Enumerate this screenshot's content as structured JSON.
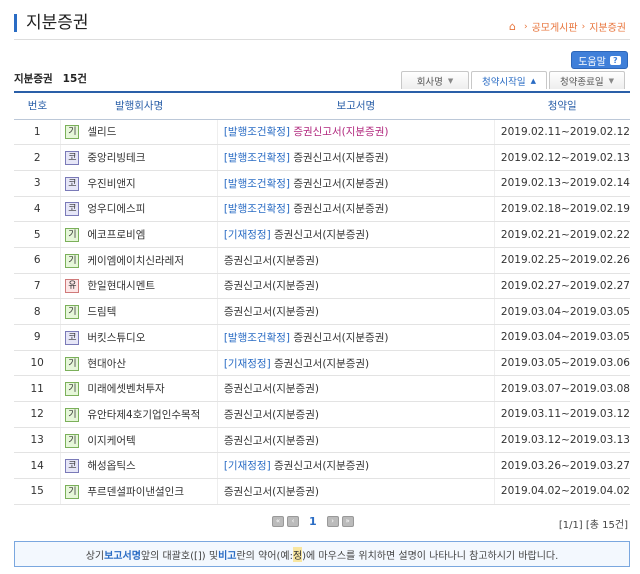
{
  "header": {
    "title": "지분증권",
    "crumbs": [
      "공모게시판",
      "지분증권"
    ]
  },
  "help_label": "도움말",
  "count": {
    "label": "지분증권",
    "value": "15건"
  },
  "sort_tabs": [
    {
      "label": "회사명",
      "active": false
    },
    {
      "label": "청약시작일",
      "active": true
    },
    {
      "label": "청약종료일",
      "active": false
    }
  ],
  "columns": [
    "번호",
    "발행회사명",
    "보고서명",
    "청약일"
  ],
  "rows": [
    {
      "no": "1",
      "market": "기",
      "company": "셀리드",
      "tag": "[발행조건확정]",
      "report": "증권신고서(지분증권)",
      "period": "2019.02.11~2019.02.12",
      "pink": true
    },
    {
      "no": "2",
      "market": "코",
      "company": "중앙리빙테크",
      "tag": "[발행조건확정]",
      "report": "증권신고서(지분증권)",
      "period": "2019.02.12~2019.02.13",
      "pink": false
    },
    {
      "no": "3",
      "market": "코",
      "company": "우진비앤지",
      "tag": "[발행조건확정]",
      "report": "증권신고서(지분증권)",
      "period": "2019.02.13~2019.02.14",
      "pink": false
    },
    {
      "no": "4",
      "market": "코",
      "company": "엉우디에스피",
      "tag": "[발행조건확정]",
      "report": "증권신고서(지분증권)",
      "period": "2019.02.18~2019.02.19",
      "pink": false
    },
    {
      "no": "5",
      "market": "기",
      "company": "에코프로비엠",
      "tag": "[기재정정]",
      "report": "증권신고서(지분증권)",
      "period": "2019.02.21~2019.02.22",
      "pink": false
    },
    {
      "no": "6",
      "market": "기",
      "company": "케이엠에이치신라레저",
      "tag": "",
      "report": "증권신고서(지분증권)",
      "period": "2019.02.25~2019.02.26",
      "pink": false
    },
    {
      "no": "7",
      "market": "유",
      "company": "한일현대시멘트",
      "tag": "",
      "report": "증권신고서(지분증권)",
      "period": "2019.02.27~2019.02.27",
      "pink": false
    },
    {
      "no": "8",
      "market": "기",
      "company": "드림텍",
      "tag": "",
      "report": "증권신고서(지분증권)",
      "period": "2019.03.04~2019.03.05",
      "pink": false
    },
    {
      "no": "9",
      "market": "코",
      "company": "버킷스튜디오",
      "tag": "[발행조건확정]",
      "report": "증권신고서(지분증권)",
      "period": "2019.03.04~2019.03.05",
      "pink": false
    },
    {
      "no": "10",
      "market": "기",
      "company": "현대아산",
      "tag": "[기재정정]",
      "report": "증권신고서(지분증권)",
      "period": "2019.03.05~2019.03.06",
      "pink": false
    },
    {
      "no": "11",
      "market": "기",
      "company": "미래에셋벤처투자",
      "tag": "",
      "report": "증권신고서(지분증권)",
      "period": "2019.03.07~2019.03.08",
      "pink": false
    },
    {
      "no": "12",
      "market": "기",
      "company": "유안타제4호기업인수목적",
      "tag": "",
      "report": "증권신고서(지분증권)",
      "period": "2019.03.11~2019.03.12",
      "pink": false
    },
    {
      "no": "13",
      "market": "기",
      "company": "이지케어텍",
      "tag": "",
      "report": "증권신고서(지분증권)",
      "period": "2019.03.12~2019.03.13",
      "pink": false
    },
    {
      "no": "14",
      "market": "코",
      "company": "해성옵틱스",
      "tag": "[기재정정]",
      "report": "증권신고서(지분증권)",
      "period": "2019.03.26~2019.03.27",
      "pink": false
    },
    {
      "no": "15",
      "market": "기",
      "company": "푸르덴셜파이낸셜인크",
      "tag": "",
      "report": "증권신고서(지분증권)",
      "period": "2019.04.02~2019.04.02",
      "pink": false
    }
  ],
  "pager": {
    "current": "1",
    "info": "[1/1] [총 15건]"
  },
  "notice": {
    "p1": "상기 ",
    "h1": "보고서명",
    "p2": " 앞의 대괄호([]) 및 ",
    "h2": "비고",
    "p3": "란의 약어(예:",
    "ex": "정",
    "p4": ")에 마우스를 위치하면 설명이 나타나니 참고하시기 바랍니다."
  }
}
